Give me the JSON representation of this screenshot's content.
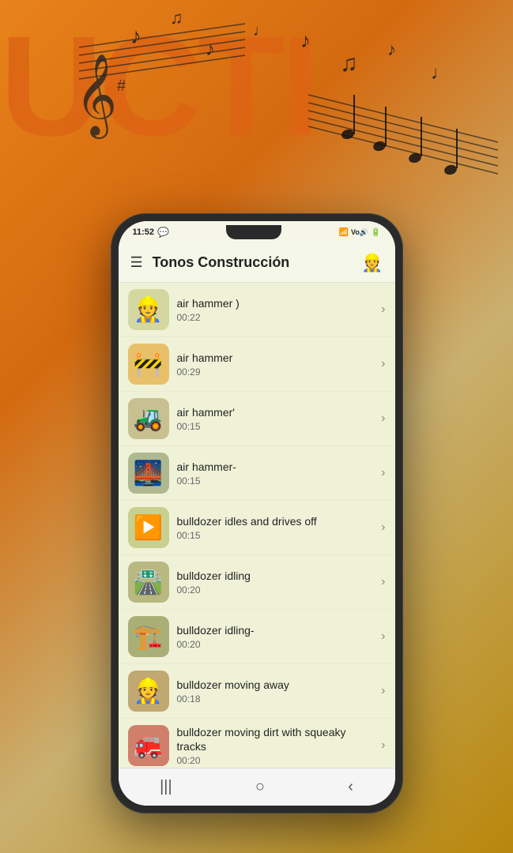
{
  "background": {
    "text_left": "UCTI"
  },
  "status_bar": {
    "time": "11:52",
    "icons_right": "📶 📶 🔋"
  },
  "header": {
    "title": "Tonos Construcción",
    "menu_icon": "☰",
    "header_emoji": "👷"
  },
  "list_items": [
    {
      "id": 1,
      "title": "air hammer )",
      "duration": "00:22",
      "emoji": "👷"
    },
    {
      "id": 2,
      "title": "air hammer",
      "duration": "00:29",
      "emoji": "🚧"
    },
    {
      "id": 3,
      "title": "air hammer'",
      "duration": "00:15",
      "emoji": "🚜"
    },
    {
      "id": 4,
      "title": "air hammer-",
      "duration": "00:15",
      "emoji": "🌉"
    },
    {
      "id": 5,
      "title": "bulldozer idles and drives off",
      "duration": "00:15",
      "emoji": "▶️"
    },
    {
      "id": 6,
      "title": "bulldozer idling",
      "duration": "00:20",
      "emoji": "🛣️"
    },
    {
      "id": 7,
      "title": "bulldozer idling-",
      "duration": "00:20",
      "emoji": "🏗️"
    },
    {
      "id": 8,
      "title": "bulldozer moving away",
      "duration": "00:18",
      "emoji": "👷"
    },
    {
      "id": 9,
      "title": "bulldozer moving dirt with squeaky tracks",
      "duration": "00:20",
      "emoji": "🚒"
    }
  ],
  "nav_bar": {
    "back": "|||",
    "home": "○",
    "recent": "‹"
  }
}
